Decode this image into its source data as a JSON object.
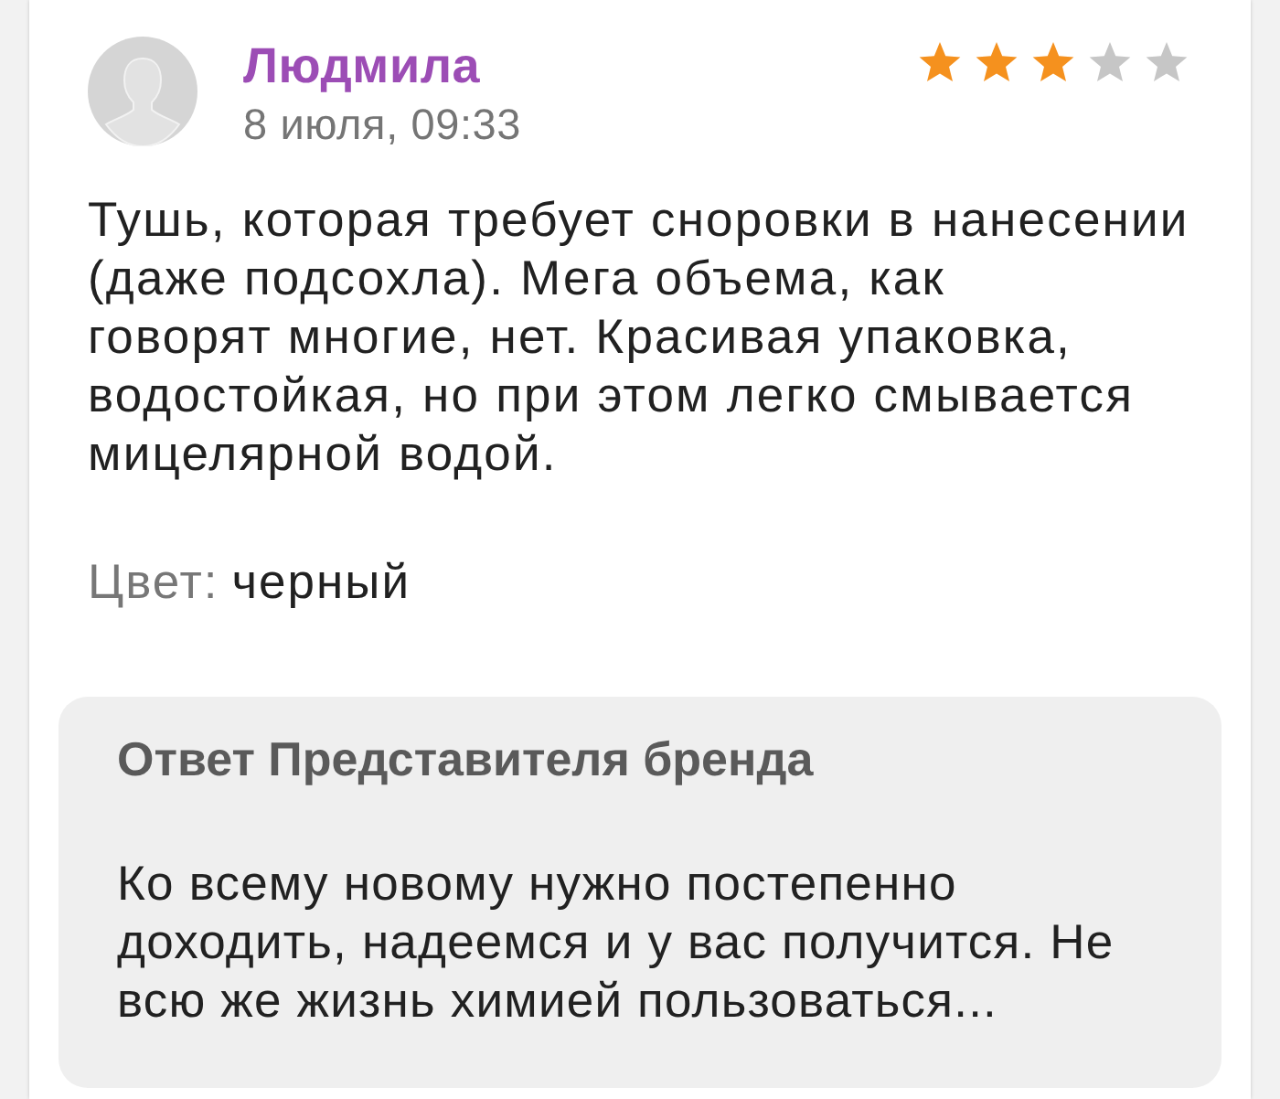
{
  "review": {
    "author": "Людмила",
    "date": "8 июля, 09:33",
    "stars": 3,
    "text": "Тушь, которая требует сноровки в нанесении\n(даже подсохла). Мега объема, как\nговорят многие, нет. Красивая упаковка,\nводостойкая, но при этом легко смывается\nмицелярной водой.",
    "attributes": [
      {
        "label": "Цвет:",
        "value": "черный"
      }
    ]
  },
  "brand_reply": {
    "title": "Ответ Представителя бренда",
    "text": "Ко всему новому нужно постепенно\nдоходить, надеемся и у вас получится. Не\nвсю же жизнь химией пользоваться..."
  }
}
